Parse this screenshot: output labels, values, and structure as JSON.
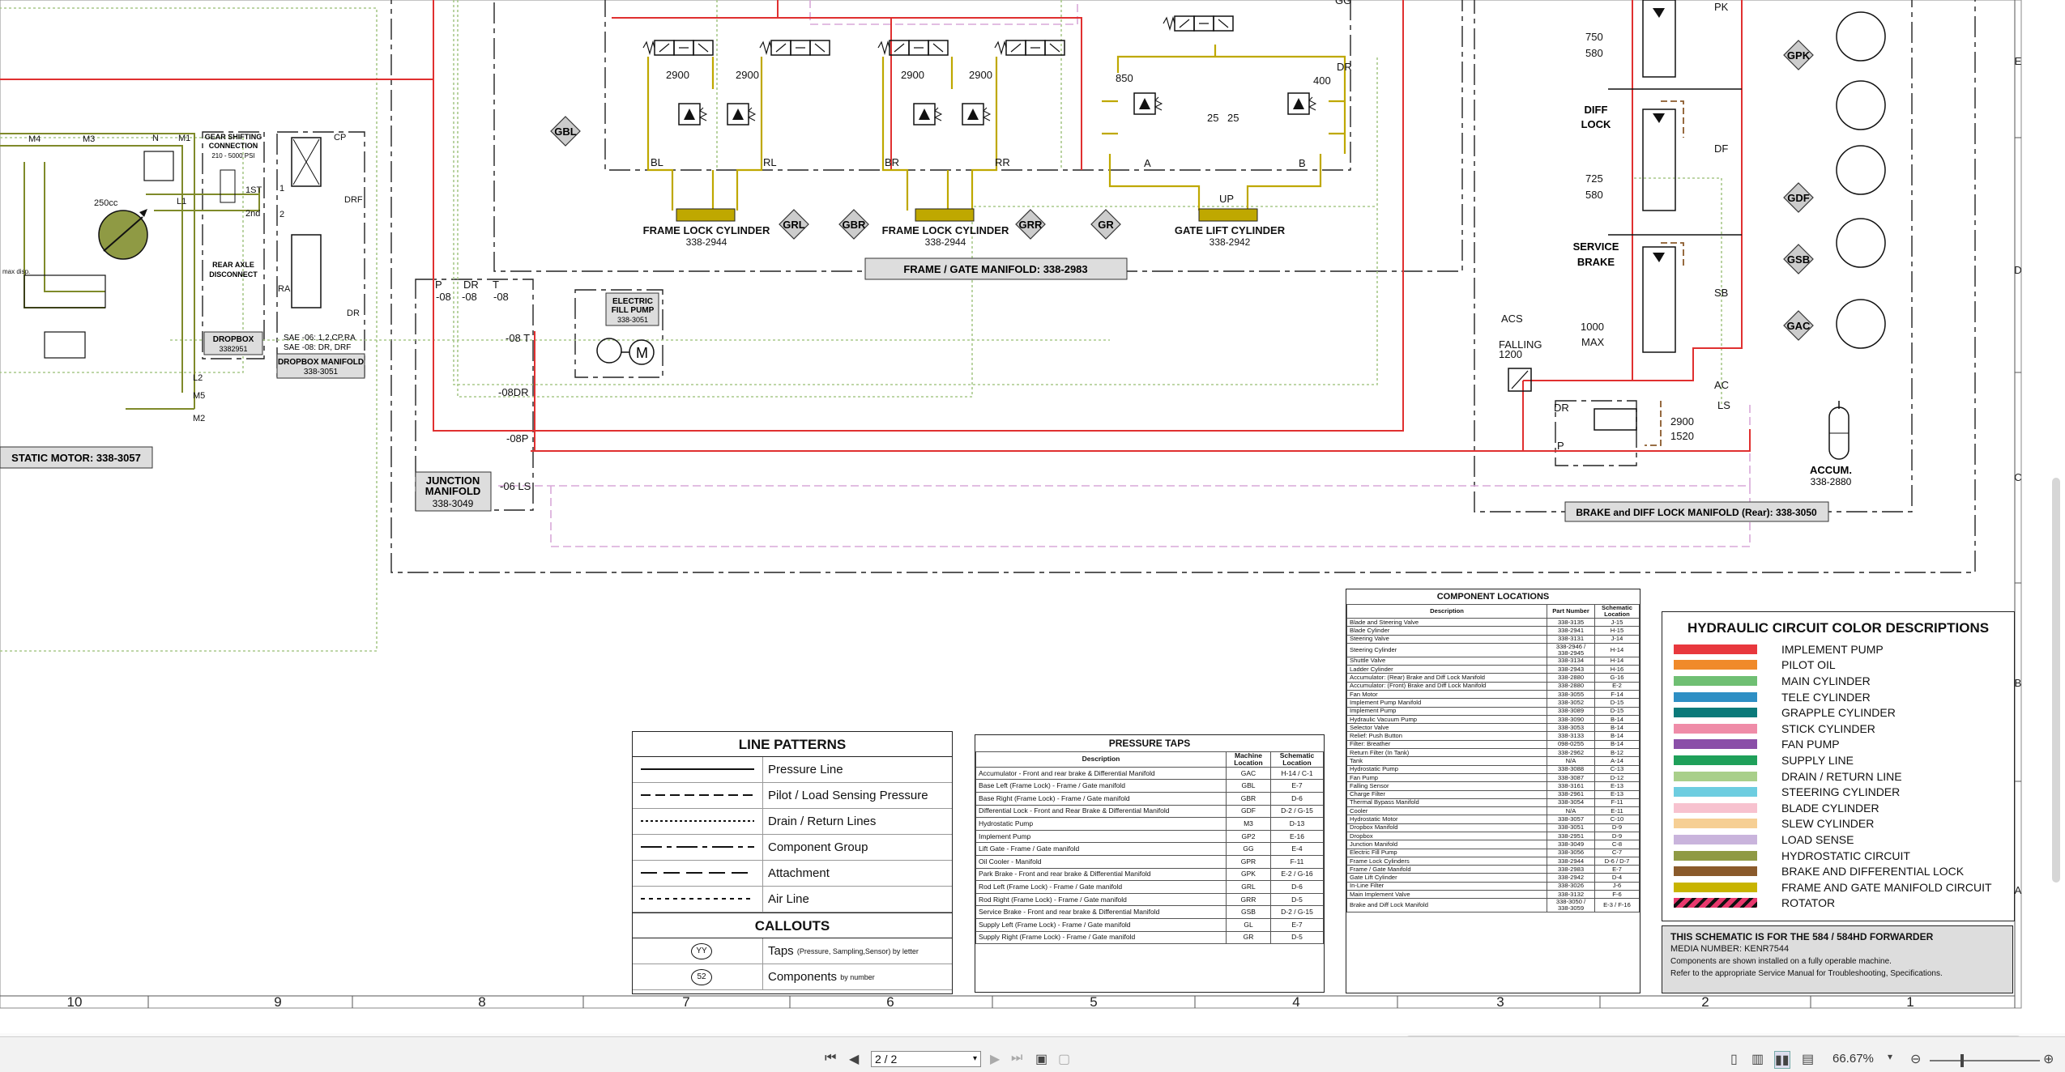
{
  "schematic": {
    "components": {
      "frame_lock_cyl_left": {
        "name": "FRAME LOCK CYLINDER",
        "part": "338-2944"
      },
      "frame_lock_cyl_right": {
        "name": "FRAME LOCK CYLINDER",
        "part": "338-2944"
      },
      "gate_lift_cyl": {
        "name": "GATE LIFT CYLINDER",
        "part": "338-2942"
      },
      "frame_gate_manifold": "FRAME / GATE MANIFOLD: 338-2983",
      "static_motor": "STATIC MOTOR: 338-3057",
      "junction_manifold": {
        "l1": "JUNCTION",
        "l2": "MANIFOLD",
        "part": "338-3049"
      },
      "dropbox_manifold": {
        "name": "DROPBOX MANIFOLD",
        "part": "338-3051",
        "sae1": "SAE -06: 1,2,CP,RA",
        "sae2": "SAE -08: DR, DRF"
      },
      "dropbox": {
        "name": "DROPBOX",
        "part": "3382951"
      },
      "electric_fill_pump": {
        "l1": "ELECTRIC",
        "l2": "FILL PUMP",
        "part": "338-3051"
      },
      "brake_diff_manifold": "BRAKE and DIFF LOCK MANIFOLD (Rear): 338-3050",
      "accum": {
        "name": "ACCUM.",
        "part": "338-2880"
      },
      "gear_shift": {
        "l1": "GEAR SHIFTING",
        "l2": "CONNECTION",
        "l3": "210 - 5000 PSI"
      },
      "rear_axle": {
        "l1": "REAR AXLE",
        "l2": "DISCONNECT"
      },
      "diff_lock": {
        "l1": "DIFF",
        "l2": "LOCK"
      },
      "service_brake": {
        "l1": "SERVICE",
        "l2": "BRAKE"
      }
    },
    "taps": {
      "gbl": "GBL",
      "grl": "GRL",
      "gbr": "GBR",
      "grr": "GRR",
      "gr": "GR",
      "gpk": "GPK",
      "gdf": "GDF",
      "gsb": "GSB",
      "gac": "GAC"
    },
    "labels": {
      "p2900a": "2900",
      "p2900b": "2900",
      "p2900c": "2900",
      "p2900d": "2900",
      "bl": "BL",
      "rl": "RL",
      "br": "BR",
      "rr": "RR",
      "p850": "850",
      "p400": "400",
      "p25a": "25",
      "p25b": "25",
      "a": "A",
      "b": "B",
      "dr": "DR",
      "up": "UP",
      "gg": "GG",
      "p750": "750",
      "p580a": "580",
      "p725": "725",
      "p580b": "580",
      "p1000": "1000",
      "max": "MAX",
      "pk": "PK",
      "df": "DF",
      "sb": "SB",
      "ac": "AC",
      "ls": "LS",
      "dr2": "DR",
      "p": "P",
      "p2900e": "2900",
      "p1520": "1520",
      "acs": "ACS",
      "falling": "FALLING",
      "p1200": "1200",
      "jp": "P",
      "jdr": "DR",
      "jt": "T",
      "j08a": "-08",
      "j08b": "-08",
      "j08c": "-08",
      "t08": "-08 T",
      "dr08": "-08DR",
      "p08": "-08P",
      "ls06": "-06 LS",
      "m4": "M4",
      "m3": "M3",
      "n": "N",
      "m1": "M1",
      "l1": "L1",
      "l2": "L2",
      "m5": "M5",
      "m2": "M2",
      "cc250": "250cc",
      "maxdisp": "max disp.",
      "first": "1ST",
      "second": "2nd",
      "one": "1",
      "two": "2",
      "cp": "CP",
      "drf": "DRF",
      "ra": "RA",
      "drb": "DR"
    },
    "grid": {
      "cols": [
        "10",
        "9",
        "8",
        "7",
        "6",
        "5",
        "4",
        "3",
        "2",
        "1"
      ],
      "rows": [
        "E",
        "D",
        "C",
        "B",
        "A"
      ]
    }
  },
  "line_patterns": {
    "title": "LINE PATTERNS",
    "items": [
      {
        "label": "Pressure Line",
        "dash": ""
      },
      {
        "label": "Pilot / Load Sensing Pressure",
        "dash": "12 6"
      },
      {
        "label": "Drain / Return Lines",
        "dash": "3 3"
      },
      {
        "label": "Component Group",
        "dash": "26 6 6 6"
      },
      {
        "label": "Attachment",
        "dash": "20 8"
      },
      {
        "label": "Air Line",
        "dash": "5 5"
      }
    ],
    "callouts_title": "CALLOUTS",
    "callouts": [
      {
        "badge": "YY",
        "label": "Taps",
        "sub": "(Pressure, Sampling,Sensor) by letter"
      },
      {
        "badge": "52",
        "label": "Components",
        "sub": "by number"
      }
    ]
  },
  "pressure_taps": {
    "title": "PRESSURE TAPS",
    "headers": [
      "Description",
      "Machine Location",
      "Schematic Location"
    ],
    "rows": [
      [
        "Accumulator - Front and rear brake & Differential Manifold",
        "GAC",
        "H-14 / C-1"
      ],
      [
        "Base Left (Frame Lock) - Frame / Gate manifold",
        "GBL",
        "E-7"
      ],
      [
        "Base Right (Frame Lock) - Frame / Gate manifold",
        "GBR",
        "D-6"
      ],
      [
        "Differential Lock - Front and Rear Brake & Differential Manifold",
        "GDF",
        "D-2 / G-15"
      ],
      [
        "Hydrostatic Pump",
        "M3",
        "D-13"
      ],
      [
        "Implement Pump",
        "GP2",
        "E-16"
      ],
      [
        "Lift Gate - Frame / Gate manifold",
        "GG",
        "E-4"
      ],
      [
        "Oil Cooler - Manifold",
        "GPR",
        "F-11"
      ],
      [
        "Park Brake - Front and rear brake & Differential Manifold",
        "GPK",
        "E-2 / G-16"
      ],
      [
        "Rod Left (Frame Lock) - Frame / Gate manifold",
        "GRL",
        "D-6"
      ],
      [
        "Rod Right (Frame Lock) - Frame / Gate manifold",
        "GRR",
        "D-5"
      ],
      [
        "Service Brake - Front and rear brake & Differential Manifold",
        "GSB",
        "D-2 / G-15"
      ],
      [
        "Supply Left (Frame Lock) - Frame / Gate manifold",
        "GL",
        "E-7"
      ],
      [
        "Supply Right (Frame Lock) - Frame / Gate manifold",
        "GR",
        "D-5"
      ]
    ]
  },
  "component_locations": {
    "title": "COMPONENT LOCATIONS",
    "headers": [
      "Description",
      "Part Number",
      "Schematic Location"
    ],
    "rows": [
      [
        "Blade and Steering Valve",
        "338-3135",
        "J-15"
      ],
      [
        "Blade Cylinder",
        "338-2941",
        "H-15"
      ],
      [
        "Steering Valve",
        "338-3131",
        "J-14"
      ],
      [
        "Steering Cylinder",
        "338-2946 / 338-2945",
        "H-14"
      ],
      [
        "Shuttle Valve",
        "338-3134",
        "H-14"
      ],
      [
        "Ladder Cylinder",
        "338-2943",
        "H-16"
      ],
      [
        "Accumulator: (Rear) Brake and Diff Lock Manifold",
        "338-2880",
        "G-16"
      ],
      [
        "Accumulator: (Front) Brake and Diff Lock Manifold",
        "338-2880",
        "E-2"
      ],
      [
        "Fan Motor",
        "338-3055",
        "F-14"
      ],
      [
        "Implement Pump Manifold",
        "338-3052",
        "D-15"
      ],
      [
        "Implement Pump",
        "338-3089",
        "D-15"
      ],
      [
        "Hydraulic Vacuum Pump",
        "338-3090",
        "B-14"
      ],
      [
        "Selector Valve",
        "338-3053",
        "B-14"
      ],
      [
        "Relief: Push Button",
        "338-3133",
        "B-14"
      ],
      [
        "Filter: Breather",
        "098-0255",
        "B-14"
      ],
      [
        "Return Filter (In Tank)",
        "338-2962",
        "B-12"
      ],
      [
        "Tank",
        "N/A",
        "A-14"
      ],
      [
        "Hydrostatic Pump",
        "338-3088",
        "C-13"
      ],
      [
        "Fan Pump",
        "338-3087",
        "D-12"
      ],
      [
        "Falling Sensor",
        "338-3161",
        "E-13"
      ],
      [
        "Charge Filter",
        "338-2961",
        "E-13"
      ],
      [
        "Thermal Bypass Manifold",
        "338-3054",
        "F-11"
      ],
      [
        "Cooler",
        "N/A",
        "E-11"
      ],
      [
        "Hydrostatic Motor",
        "338-3057",
        "C-10"
      ],
      [
        "Dropbox Manifold",
        "338-3051",
        "D-9"
      ],
      [
        "Dropbox",
        "338-2951",
        "D-9"
      ],
      [
        "Junction Manifold",
        "338-3049",
        "C-8"
      ],
      [
        "Electric Fill Pump",
        "338-3056",
        "C-7"
      ],
      [
        "Frame Lock Cylinders",
        "338-2944",
        "D-6 / D-7"
      ],
      [
        "Frame / Gate Manifold",
        "338-2983",
        "E-7"
      ],
      [
        "Gate Lift Cylinder",
        "338-2942",
        "D-4"
      ],
      [
        "In-Line Filter",
        "338-3026",
        "J-6"
      ],
      [
        "Main Implement Valve",
        "338-3132",
        "F-6"
      ],
      [
        "Brake and Diff Lock Manifold",
        "338-3050 / 338-3059",
        "E-3 / F-16"
      ]
    ]
  },
  "color_legend": {
    "title": "HYDRAULIC CIRCUIT COLOR DESCRIPTIONS",
    "items": [
      {
        "label": "IMPLEMENT PUMP",
        "color": "#e8383d"
      },
      {
        "label": "PILOT OIL",
        "color": "#f08a2a"
      },
      {
        "label": "MAIN CYLINDER",
        "color": "#6fbf73"
      },
      {
        "label": "TELE CYLINDER",
        "color": "#2e8fc4"
      },
      {
        "label": "GRAPPLE CYLINDER",
        "color": "#0b7a7a"
      },
      {
        "label": "STICK CYLINDER",
        "color": "#ef8ca8"
      },
      {
        "label": "FAN PUMP",
        "color": "#8a4fa8"
      },
      {
        "label": "SUPPLY LINE",
        "color": "#1fa05a"
      },
      {
        "label": "DRAIN / RETURN LINE",
        "color": "#a9cf8a"
      },
      {
        "label": "STEERING CYLINDER",
        "color": "#6dcde0"
      },
      {
        "label": "BLADE CYLINDER",
        "color": "#f7c2cf"
      },
      {
        "label": "SLEW CYLINDER",
        "color": "#f6cf94"
      },
      {
        "label": "LOAD SENSE",
        "color": "#c9b4dc"
      },
      {
        "label": "HYDROSTATIC CIRCUIT",
        "color": "#8f9a44"
      },
      {
        "label": "BRAKE AND DIFFERENTIAL LOCK",
        "color": "#8a5a2b"
      },
      {
        "label": "FRAME AND GATE MANIFOLD CIRCUIT",
        "color": "#c8b400"
      },
      {
        "label": "ROTATOR",
        "color": "#e8386d"
      }
    ]
  },
  "note": {
    "title": "THIS SCHEMATIC IS FOR THE 584 / 584HD FORWARDER",
    "media": "MEDIA NUMBER: KENR7544",
    "l1": "Components are shown installed on a fully operable machine.",
    "l2": "Refer to the appropriate Service Manual for Troubleshooting, Specifications."
  },
  "viewer": {
    "page_value": "2 / 2",
    "zoom": "66.67%"
  },
  "colors": {
    "pressure": "#e03030",
    "frame": "#bfa800",
    "hydro": "#7f8a2a",
    "drain": "#a8c88a",
    "ls": "#d8a8d8",
    "brake": "#8a5a2b"
  }
}
